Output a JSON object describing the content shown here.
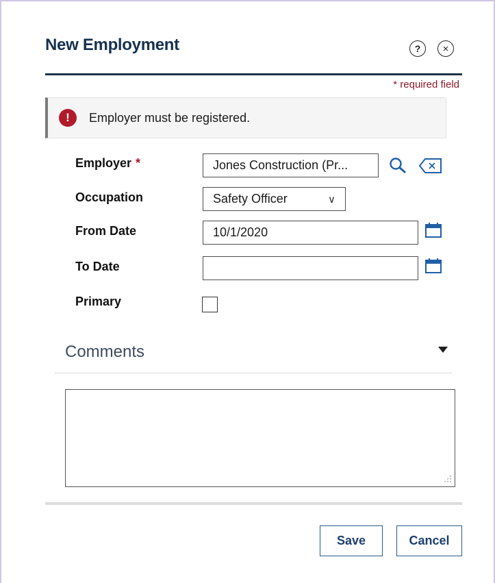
{
  "dialog": {
    "title": "New Employment",
    "help_glyph": "?",
    "close_glyph": "×",
    "required_note": "* required field"
  },
  "alert": {
    "icon_glyph": "!",
    "message": "Employer must be registered."
  },
  "form": {
    "employer": {
      "label": "Employer",
      "required_mark": "*",
      "value": "Jones Construction (Pr..."
    },
    "occupation": {
      "label": "Occupation",
      "value": "Safety Officer",
      "chevron": "∨"
    },
    "from_date": {
      "label": "From Date",
      "value": "10/1/2020"
    },
    "to_date": {
      "label": "To Date",
      "value": ""
    },
    "primary": {
      "label": "Primary",
      "checked": false
    }
  },
  "comments": {
    "title": "Comments",
    "value": ""
  },
  "footer": {
    "save_label": "Save",
    "cancel_label": "Cancel"
  },
  "colors": {
    "title": "#17314f",
    "accent_blue": "#1f5fa6",
    "error_red": "#b11a2a",
    "required_red": "#8c1a2b"
  },
  "icons": {
    "search": "search-icon",
    "clear": "clear-backspace-icon",
    "calendar": "calendar-icon",
    "alert": "exclamation-circle-icon"
  }
}
